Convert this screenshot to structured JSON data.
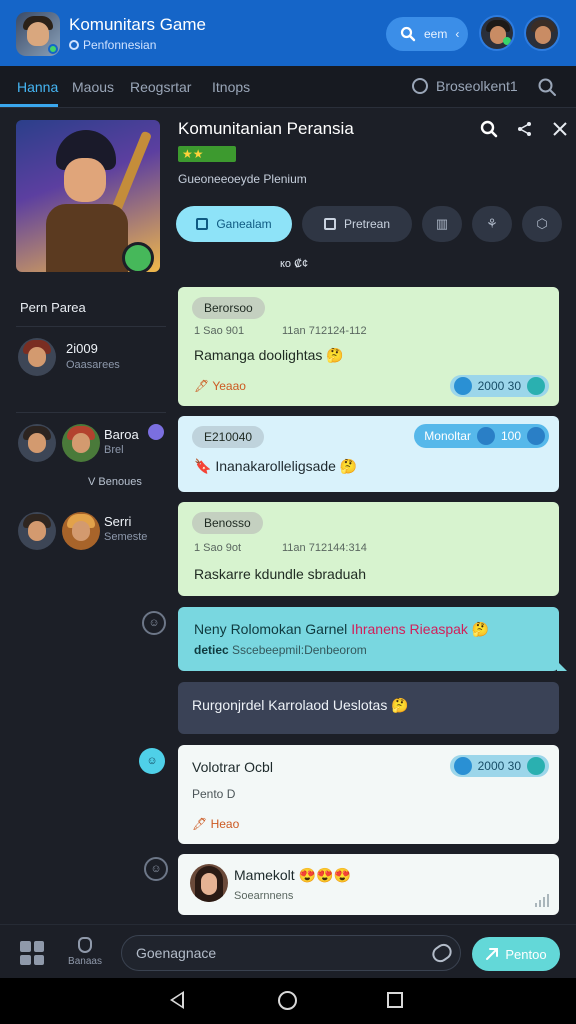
{
  "topbar": {
    "title": "Komunitars Game",
    "subtitle": "Penfonnesian",
    "search_label": "eem",
    "back_glyph": "‹"
  },
  "tabs": [
    {
      "label": "Hanna",
      "active": true
    },
    {
      "label": "Maous"
    },
    {
      "label": "Reogsrtar"
    },
    {
      "label": "Itnops"
    }
  ],
  "tab_right": {
    "label": "Broseolkent1"
  },
  "game": {
    "title": "Komunitanian Peransia",
    "stars": "★★",
    "description": "Gueoneeoeyde Plenium",
    "meta": "ко ₡¢"
  },
  "actions": {
    "primary": "Ganealam",
    "secondary": "Pretrean",
    "icon_1": "▥",
    "icon_2": "⚘",
    "icon_3": "⬡"
  },
  "left": {
    "section_title": "Pern Parea",
    "members": [
      {
        "name": "2i009",
        "sub": "Oaasarees"
      },
      {
        "name": "Baroa",
        "sub": "Brel"
      },
      {
        "name": "Serri",
        "sub": "Semeste"
      }
    ],
    "group_label": "V Benoues",
    "icon_glyph": "☺"
  },
  "messages": [
    {
      "chip": "Berorsoo",
      "meta_left": "1 Sao 901",
      "meta_right": "11an 712124-112",
      "text": "Ramanga doolightas 🤔",
      "attach": "🖋 Yeaao",
      "stat": "2000 30"
    },
    {
      "chip": "E210040",
      "tag": "Monoltar",
      "tag_num": "100",
      "text": "🔖 Inanakarolleligsade 🤔"
    },
    {
      "chip": "Benosso",
      "meta_left": "1 Sao 9ot",
      "meta_right": "11an 712144:314",
      "text": "Raskarre kdundle sbraduah"
    },
    {
      "text_a": "Neny Rolomokan Garnel",
      "text_b": "Ihranens Rieaspak",
      "emoji": "🤔",
      "sub_bold": "detiec",
      "sub_rest": "Sscebeepmil:Denbeorom"
    },
    {
      "text": "Rurgonjrdel Karrolaod Ueslotas 🤔"
    },
    {
      "title": "Volotrar Ocbl",
      "sub": "Pento D",
      "attach": "🖋 Heao",
      "stat": "2000 30"
    },
    {
      "name": "Mamekolt",
      "emojis": "😍😍😍",
      "sub": "Soearnnens"
    }
  ],
  "composer": {
    "placeholder": "Goenagnace",
    "shield_label": "Banaas",
    "send_label": "Pentoo"
  },
  "colors": {
    "topbar": "#1565c8",
    "accent": "#45b5f3",
    "background": "#1c1f27"
  }
}
